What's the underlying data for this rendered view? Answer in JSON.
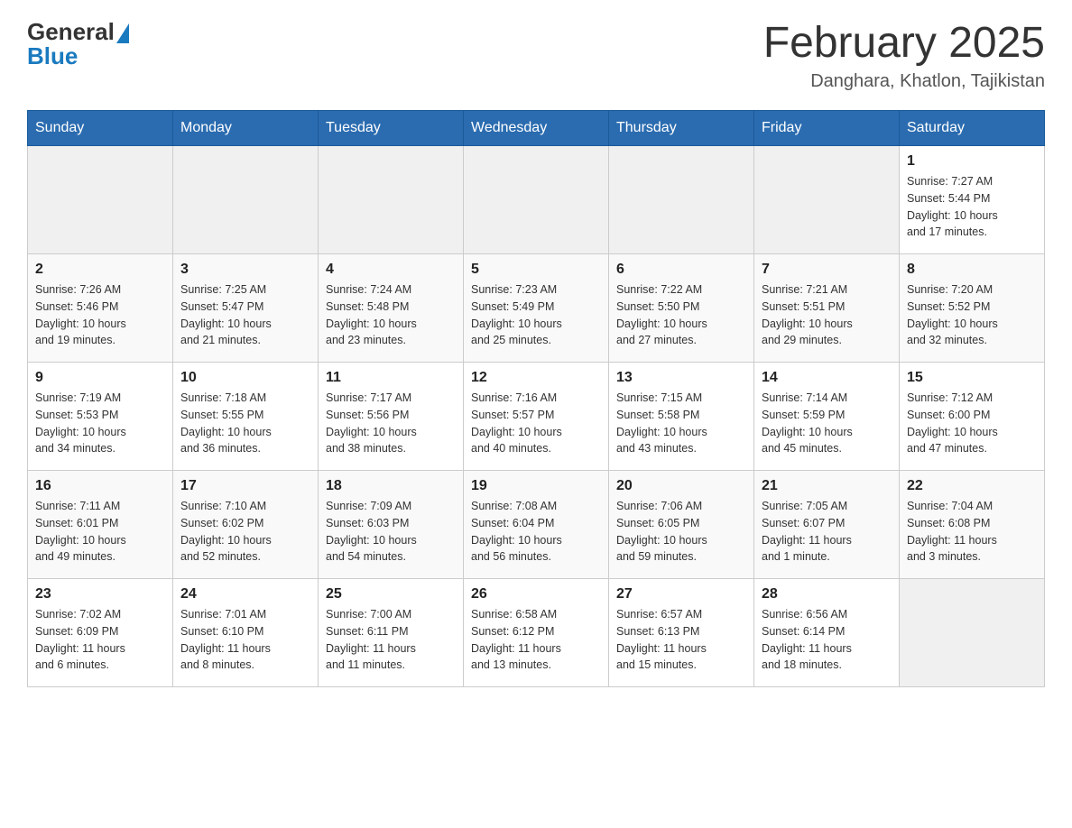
{
  "header": {
    "logo_general": "General",
    "logo_blue": "Blue",
    "month_title": "February 2025",
    "location": "Danghara, Khatlon, Tajikistan"
  },
  "days_of_week": [
    "Sunday",
    "Monday",
    "Tuesday",
    "Wednesday",
    "Thursday",
    "Friday",
    "Saturday"
  ],
  "weeks": [
    [
      {
        "day": "",
        "info": ""
      },
      {
        "day": "",
        "info": ""
      },
      {
        "day": "",
        "info": ""
      },
      {
        "day": "",
        "info": ""
      },
      {
        "day": "",
        "info": ""
      },
      {
        "day": "",
        "info": ""
      },
      {
        "day": "1",
        "info": "Sunrise: 7:27 AM\nSunset: 5:44 PM\nDaylight: 10 hours\nand 17 minutes."
      }
    ],
    [
      {
        "day": "2",
        "info": "Sunrise: 7:26 AM\nSunset: 5:46 PM\nDaylight: 10 hours\nand 19 minutes."
      },
      {
        "day": "3",
        "info": "Sunrise: 7:25 AM\nSunset: 5:47 PM\nDaylight: 10 hours\nand 21 minutes."
      },
      {
        "day": "4",
        "info": "Sunrise: 7:24 AM\nSunset: 5:48 PM\nDaylight: 10 hours\nand 23 minutes."
      },
      {
        "day": "5",
        "info": "Sunrise: 7:23 AM\nSunset: 5:49 PM\nDaylight: 10 hours\nand 25 minutes."
      },
      {
        "day": "6",
        "info": "Sunrise: 7:22 AM\nSunset: 5:50 PM\nDaylight: 10 hours\nand 27 minutes."
      },
      {
        "day": "7",
        "info": "Sunrise: 7:21 AM\nSunset: 5:51 PM\nDaylight: 10 hours\nand 29 minutes."
      },
      {
        "day": "8",
        "info": "Sunrise: 7:20 AM\nSunset: 5:52 PM\nDaylight: 10 hours\nand 32 minutes."
      }
    ],
    [
      {
        "day": "9",
        "info": "Sunrise: 7:19 AM\nSunset: 5:53 PM\nDaylight: 10 hours\nand 34 minutes."
      },
      {
        "day": "10",
        "info": "Sunrise: 7:18 AM\nSunset: 5:55 PM\nDaylight: 10 hours\nand 36 minutes."
      },
      {
        "day": "11",
        "info": "Sunrise: 7:17 AM\nSunset: 5:56 PM\nDaylight: 10 hours\nand 38 minutes."
      },
      {
        "day": "12",
        "info": "Sunrise: 7:16 AM\nSunset: 5:57 PM\nDaylight: 10 hours\nand 40 minutes."
      },
      {
        "day": "13",
        "info": "Sunrise: 7:15 AM\nSunset: 5:58 PM\nDaylight: 10 hours\nand 43 minutes."
      },
      {
        "day": "14",
        "info": "Sunrise: 7:14 AM\nSunset: 5:59 PM\nDaylight: 10 hours\nand 45 minutes."
      },
      {
        "day": "15",
        "info": "Sunrise: 7:12 AM\nSunset: 6:00 PM\nDaylight: 10 hours\nand 47 minutes."
      }
    ],
    [
      {
        "day": "16",
        "info": "Sunrise: 7:11 AM\nSunset: 6:01 PM\nDaylight: 10 hours\nand 49 minutes."
      },
      {
        "day": "17",
        "info": "Sunrise: 7:10 AM\nSunset: 6:02 PM\nDaylight: 10 hours\nand 52 minutes."
      },
      {
        "day": "18",
        "info": "Sunrise: 7:09 AM\nSunset: 6:03 PM\nDaylight: 10 hours\nand 54 minutes."
      },
      {
        "day": "19",
        "info": "Sunrise: 7:08 AM\nSunset: 6:04 PM\nDaylight: 10 hours\nand 56 minutes."
      },
      {
        "day": "20",
        "info": "Sunrise: 7:06 AM\nSunset: 6:05 PM\nDaylight: 10 hours\nand 59 minutes."
      },
      {
        "day": "21",
        "info": "Sunrise: 7:05 AM\nSunset: 6:07 PM\nDaylight: 11 hours\nand 1 minute."
      },
      {
        "day": "22",
        "info": "Sunrise: 7:04 AM\nSunset: 6:08 PM\nDaylight: 11 hours\nand 3 minutes."
      }
    ],
    [
      {
        "day": "23",
        "info": "Sunrise: 7:02 AM\nSunset: 6:09 PM\nDaylight: 11 hours\nand 6 minutes."
      },
      {
        "day": "24",
        "info": "Sunrise: 7:01 AM\nSunset: 6:10 PM\nDaylight: 11 hours\nand 8 minutes."
      },
      {
        "day": "25",
        "info": "Sunrise: 7:00 AM\nSunset: 6:11 PM\nDaylight: 11 hours\nand 11 minutes."
      },
      {
        "day": "26",
        "info": "Sunrise: 6:58 AM\nSunset: 6:12 PM\nDaylight: 11 hours\nand 13 minutes."
      },
      {
        "day": "27",
        "info": "Sunrise: 6:57 AM\nSunset: 6:13 PM\nDaylight: 11 hours\nand 15 minutes."
      },
      {
        "day": "28",
        "info": "Sunrise: 6:56 AM\nSunset: 6:14 PM\nDaylight: 11 hours\nand 18 minutes."
      },
      {
        "day": "",
        "info": ""
      }
    ]
  ]
}
